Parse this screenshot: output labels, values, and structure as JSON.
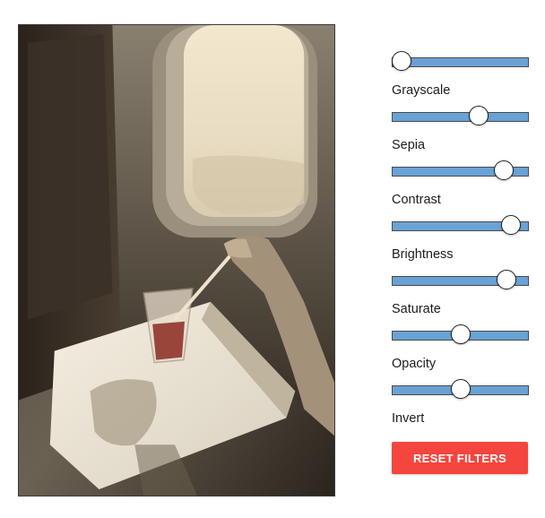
{
  "filters": {
    "sliders": [
      {
        "name": "grayscale",
        "value": 0.0
      },
      {
        "name": "sepia",
        "value": 0.66
      },
      {
        "name": "contrast",
        "value": 0.87
      },
      {
        "name": "brightness",
        "value": 0.93
      },
      {
        "name": "saturate",
        "value": 0.89
      },
      {
        "name": "opacity",
        "value": 0.5
      },
      {
        "name": "invert",
        "value": 0.5
      }
    ],
    "labels": {
      "grayscale": "Grayscale",
      "sepia": "Sepia",
      "contrast": "Contrast",
      "brightness": "Brightness",
      "saturate": "Saturate",
      "opacity": "Opacity",
      "invert": "Invert"
    },
    "reset_label": "RESET FILTERS"
  },
  "colors": {
    "track": "#6aa2d6",
    "reset_button": "#f4453e",
    "thumb": "#ffffff"
  }
}
